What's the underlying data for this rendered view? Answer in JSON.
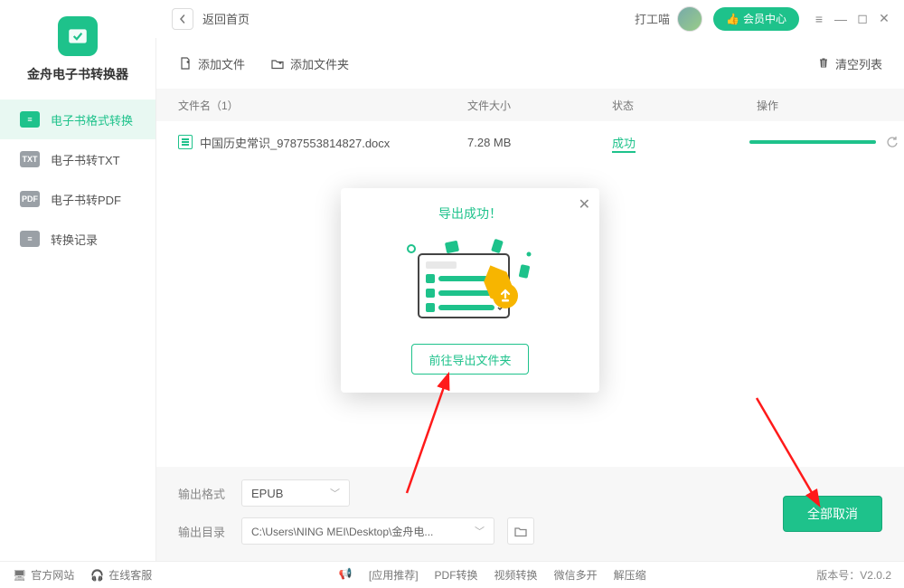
{
  "titlebar": {
    "back": "返回首页",
    "user": "打工喵",
    "vip": "会员中心"
  },
  "app_title": "金舟电子书转换器",
  "sidebar": {
    "items": [
      {
        "label": "电子书格式转换"
      },
      {
        "label": "电子书转TXT"
      },
      {
        "label": "电子书转PDF"
      },
      {
        "label": "转换记录"
      }
    ]
  },
  "toolbar": {
    "add_file": "添加文件",
    "add_folder": "添加文件夹",
    "clear": "清空列表"
  },
  "table": {
    "head": {
      "name": "文件名（1）",
      "size": "文件大小",
      "status": "状态",
      "ops": "操作"
    },
    "rows": [
      {
        "name": "中国历史常识_9787553814827.docx",
        "size": "7.28 MB",
        "status": "成功"
      }
    ]
  },
  "bottom": {
    "format_label": "输出格式",
    "format_value": "EPUB",
    "dir_label": "输出目录",
    "dir_value": "C:\\Users\\NING MEI\\Desktop\\金舟电...",
    "big_btn": "全部取消"
  },
  "statusbar": {
    "site": "官方网站",
    "cs": "在线客服",
    "rec": "[应用推荐]",
    "pdf": "PDF转换",
    "video": "视频转换",
    "wx": "微信多开",
    "zip": "解压缩",
    "version": "版本号：V2.0.2"
  },
  "modal": {
    "title": "导出成功！",
    "btn": "前往导出文件夹"
  }
}
